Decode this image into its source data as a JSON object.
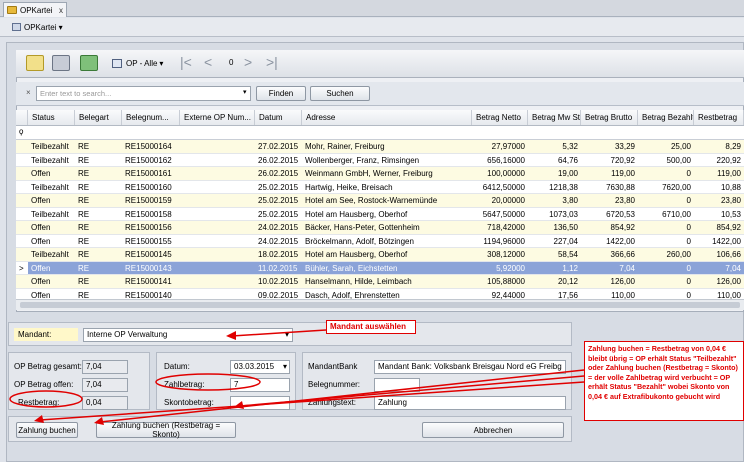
{
  "window": {
    "tab_label": "OPKartei",
    "tab_close": "x",
    "subtab_label": "OPKartei ▾"
  },
  "toolbar": {
    "filter_label": "OP - Alle",
    "page_number": "0"
  },
  "search": {
    "placeholder": "Enter text to search...",
    "find_label": "Finden",
    "search_label": "Suchen"
  },
  "grid": {
    "columns": [
      "Status",
      "Belegart",
      "Belegnum...",
      "Externe OP Num...",
      "Datum",
      "Adresse",
      "Betrag Netto",
      "Betrag Mw St",
      "Betrag Brutto",
      "Betrag Bezahlt",
      "Restbetrag"
    ],
    "rows": [
      {
        "status": "Teilbezahlt",
        "art": "RE",
        "num": "RE15000164",
        "ext": "",
        "datum": "27.02.2015",
        "adresse": "Mohr, Rainer, Freiburg",
        "netto": "27,97000",
        "mwst": "5,32",
        "brutto": "33,29",
        "bezahlt": "25,00",
        "rest": "8,29"
      },
      {
        "status": "Teilbezahlt",
        "art": "RE",
        "num": "RE15000162",
        "ext": "",
        "datum": "26.02.2015",
        "adresse": "Wollenberger, Franz, Rimsingen",
        "netto": "656,16000",
        "mwst": "64,76",
        "brutto": "720,92",
        "bezahlt": "500,00",
        "rest": "220,92"
      },
      {
        "status": "Offen",
        "art": "RE",
        "num": "RE15000161",
        "ext": "",
        "datum": "26.02.2015",
        "adresse": "Weinmann GmbH, Werner, Freiburg",
        "netto": "100,00000",
        "mwst": "19,00",
        "brutto": "119,00",
        "bezahlt": "0",
        "rest": "119,00"
      },
      {
        "status": "Teilbezahlt",
        "art": "RE",
        "num": "RE15000160",
        "ext": "",
        "datum": "25.02.2015",
        "adresse": "Hartwig, Heike, Breisach",
        "netto": "6412,50000",
        "mwst": "1218,38",
        "brutto": "7630,88",
        "bezahlt": "7620,00",
        "rest": "10,88"
      },
      {
        "status": "Offen",
        "art": "RE",
        "num": "RE15000159",
        "ext": "",
        "datum": "25.02.2015",
        "adresse": "Hotel am See, Rostock-Warnemünde",
        "netto": "20,00000",
        "mwst": "3,80",
        "brutto": "23,80",
        "bezahlt": "0",
        "rest": "23,80"
      },
      {
        "status": "Teilbezahlt",
        "art": "RE",
        "num": "RE15000158",
        "ext": "",
        "datum": "25.02.2015",
        "adresse": "Hotel am Hausberg, Oberhof",
        "netto": "5647,50000",
        "mwst": "1073,03",
        "brutto": "6720,53",
        "bezahlt": "6710,00",
        "rest": "10,53"
      },
      {
        "status": "Offen",
        "art": "RE",
        "num": "RE15000156",
        "ext": "",
        "datum": "24.02.2015",
        "adresse": "Bäcker, Hans-Peter, Gottenheim",
        "netto": "718,42000",
        "mwst": "136,50",
        "brutto": "854,92",
        "bezahlt": "0",
        "rest": "854,92"
      },
      {
        "status": "Offen",
        "art": "RE",
        "num": "RE15000155",
        "ext": "",
        "datum": "24.02.2015",
        "adresse": "Bröckelmann, Adolf, Bötzingen",
        "netto": "1194,96000",
        "mwst": "227,04",
        "brutto": "1422,00",
        "bezahlt": "0",
        "rest": "1422,00"
      },
      {
        "status": "Teilbezahlt",
        "art": "RE",
        "num": "RE15000145",
        "ext": "",
        "datum": "18.02.2015",
        "adresse": "Hotel am Hausberg, Oberhof",
        "netto": "308,12000",
        "mwst": "58,54",
        "brutto": "366,66",
        "bezahlt": "260,00",
        "rest": "106,66"
      },
      {
        "status": "Offen",
        "art": "RE",
        "num": "RE15000143",
        "ext": "",
        "datum": "11.02.2015",
        "adresse": "Bühler, Sarah, Eichstetten",
        "netto": "5,92000",
        "mwst": "1,12",
        "brutto": "7,04",
        "bezahlt": "0",
        "rest": "7,04"
      },
      {
        "status": "Offen",
        "art": "RE",
        "num": "RE15000141",
        "ext": "",
        "datum": "10.02.2015",
        "adresse": "Hanselmann, Hilde, Leimbach",
        "netto": "105,88000",
        "mwst": "20,12",
        "brutto": "126,00",
        "bezahlt": "0",
        "rest": "126,00"
      },
      {
        "status": "Offen",
        "art": "RE",
        "num": "RE15000140",
        "ext": "",
        "datum": "09.02.2015",
        "adresse": "Dasch, Adolf, Ehrenstetten",
        "netto": "92,44000",
        "mwst": "17,56",
        "brutto": "110,00",
        "bezahlt": "0",
        "rest": "110,00"
      }
    ],
    "selected_index": 9,
    "row_indicator": ">",
    "filter_icon": "ϙ"
  },
  "mandant": {
    "label": "Mandant:",
    "value": "Interne OP Verwaltung"
  },
  "summary": {
    "gesamt_label": "OP Betrag gesamt:",
    "gesamt_value": "7,04",
    "offen_label": "OP Betrag offen:",
    "offen_value": "7,04",
    "rest_label": "Restbetrag:",
    "rest_value": "0,04"
  },
  "payment": {
    "datum_label": "Datum:",
    "datum_value": "03.03.2015",
    "zahl_label": "Zahlbetrag:",
    "zahl_value": "7",
    "skonto_label": "Skontobetrag:",
    "skonto_value": ""
  },
  "bank": {
    "bank_label": "MandantBank",
    "bank_value": "Mandant Bank: Volksbank Breisgau Nord eG Freibg",
    "beleg_label": "Belegnummer:",
    "beleg_value": "",
    "text_label": "Zahlungstext:",
    "text_value": "Zahlung"
  },
  "buttons": {
    "zahlung": "Zahlung buchen",
    "zahlung_skonto": "Zahlung buchen (Restbetrag = Skonto)",
    "abbrechen": "Abbrechen"
  },
  "annotations": {
    "mandant_note": "Mandant auswählen",
    "payment_note": "Zahlung buchen = Restbetrag von 0,04 € bleibt übrig = OP erhält Status \"Teilbezahlt\" oder Zahlung buchen (Restbetrag = Skonto) = der volle Zahlbetrag wird verbucht = OP erhält Status \"Bezahlt\" wobei Skonto von 0,04 € auf Extrafibukonto gebucht wird"
  },
  "colors": {
    "row_yellow": "#fdfbe2",
    "selection": "#8ba3d8",
    "annotation_red": "#e00000"
  }
}
